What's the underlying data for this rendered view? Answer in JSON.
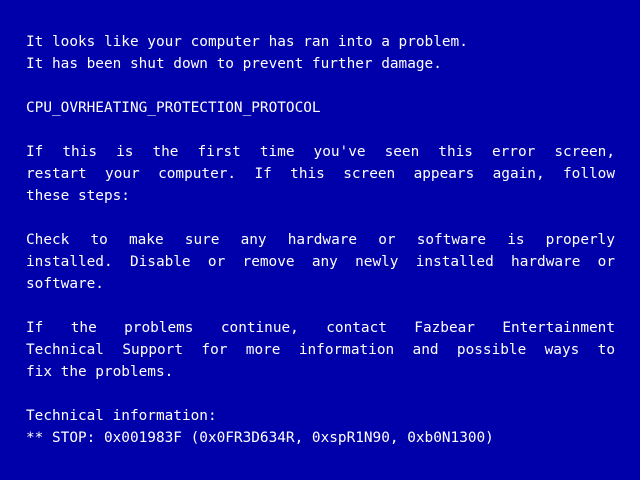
{
  "colors": {
    "background": "#0000aa",
    "text": "#ffffff"
  },
  "intro": {
    "line1": "It looks like your computer has ran into a problem.",
    "line2": "It has been shut down to prevent further damage."
  },
  "error_code": "CPU_OVRHEATING_PROTECTION_PROTOCOL",
  "first_time": {
    "line1": "If this is the first time you've seen this error screen,",
    "line2": "restart your computer. If this screen appears again, follow",
    "line3": "these steps:"
  },
  "check": {
    "line1": "Check to make sure any hardware or software is properly",
    "line2": "installed. Disable or remove any newly installed hardware or",
    "line3": "software."
  },
  "support": {
    "line1": "If the problems continue, contact Fazbear Entertainment",
    "line2": "Technical Support for more information and possible ways to",
    "line3": "fix the problems."
  },
  "technical": {
    "heading": "Technical information:",
    "stop_line": "** STOP: 0x001983F (0x0FR3D634R, 0xspR1N90, 0xb0N1300)"
  }
}
